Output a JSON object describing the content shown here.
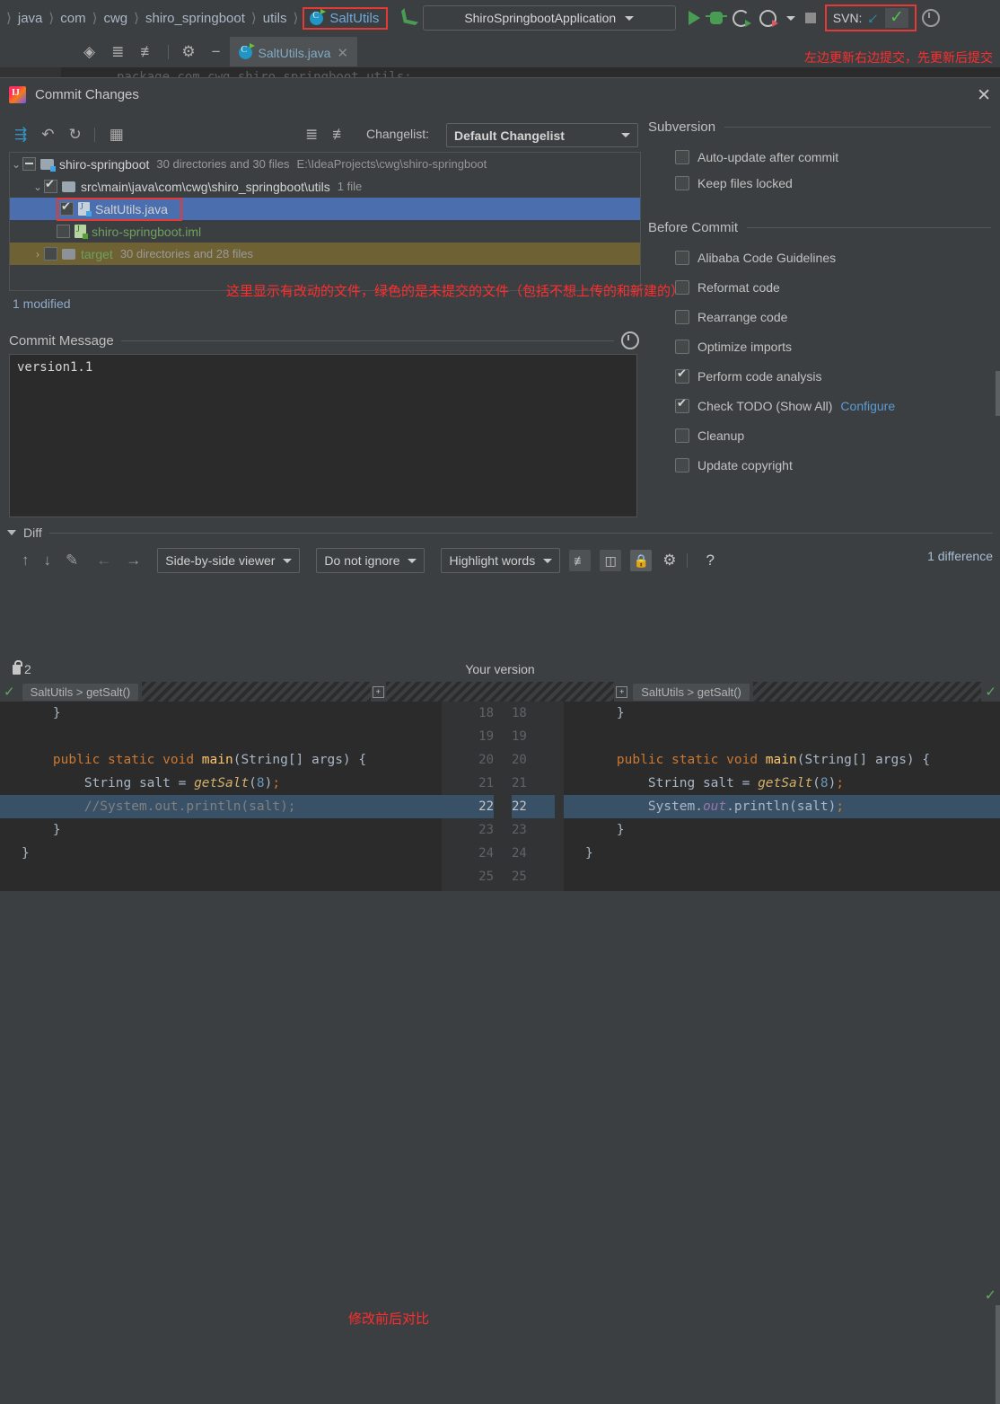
{
  "ide": {
    "breadcrumbs": [
      "java",
      "com",
      "cwg",
      "shiro_springboot",
      "utils"
    ],
    "breadcrumb_selected": "SaltUtils",
    "run_config": "ShiroSpringbootApplication",
    "svn_label": "SVN:",
    "tab_title": "SaltUtils.java",
    "editor_ghost_line": "package com.cwg.shiro_springboot.utils;",
    "annotation_top": "左边更新右边提交，先更新后提交"
  },
  "dialog": {
    "title": "Commit Changes",
    "close_label": "✕",
    "changelist_label": "Changelist:",
    "changelist_value": "Default Changelist",
    "tree": [
      {
        "name": "shiro-springboot",
        "info": "30 directories and 30 files",
        "path": "E:\\IdeaProjects\\cwg\\shiro-springboot",
        "state": "partial",
        "kind": "project"
      },
      {
        "name": "src\\main\\java\\com\\cwg\\shiro_springboot\\utils",
        "info": "1 file",
        "path": "",
        "state": "checked",
        "kind": "folder"
      },
      {
        "name": "SaltUtils.java",
        "info": "",
        "path": "",
        "state": "checked",
        "kind": "java-modified"
      },
      {
        "name": "shiro-springboot.iml",
        "info": "",
        "path": "",
        "state": "unchecked",
        "kind": "java-new"
      },
      {
        "name": "target",
        "info": "30 directories and 28 files",
        "path": "",
        "state": "unchecked",
        "kind": "folder-ignored"
      }
    ],
    "annotation_tree": "这里显示有改动的文件，绿色的是未提交的文件（包括不想上传的和新建的）",
    "modified_status": "1 modified",
    "commit_message_label": "Commit Message",
    "commit_message_value": "version1.1",
    "right_panel": {
      "section_subversion": "Subversion",
      "subversion_items": [
        {
          "label": "Auto-update after commit",
          "checked": false
        },
        {
          "label": "Keep files locked",
          "checked": false
        }
      ],
      "section_before_commit": "Before Commit",
      "before_commit_items": [
        {
          "label": "Alibaba Code Guidelines",
          "checked": false,
          "link": ""
        },
        {
          "label": "Reformat code",
          "checked": false,
          "link": ""
        },
        {
          "label": "Rearrange code",
          "checked": false,
          "link": ""
        },
        {
          "label": "Optimize imports",
          "checked": false,
          "link": ""
        },
        {
          "label": "Perform code analysis",
          "checked": true,
          "link": ""
        },
        {
          "label": "Check TODO (Show All)",
          "checked": true,
          "link": "Configure"
        },
        {
          "label": "Cleanup",
          "checked": false,
          "link": ""
        },
        {
          "label": "Update copyright",
          "checked": false,
          "link": ""
        }
      ]
    },
    "diff": {
      "section_label": "Diff",
      "viewer_mode": "Side-by-side viewer",
      "ignore_mode": "Do not ignore",
      "highlight_mode": "Highlight words",
      "help_label": "?",
      "difference_count": "1 difference",
      "lock_count": "2",
      "your_version_label": "Your version",
      "left_breadcrumb": "SaltUtils > getSalt()",
      "right_breadcrumb": "SaltUtils > getSalt()",
      "annotation": "修改前后对比",
      "line_numbers_left": [
        "18",
        "19",
        "20",
        "21",
        "22",
        "23",
        "24",
        "25"
      ],
      "line_numbers_right": [
        "18",
        "19",
        "20",
        "21",
        "22",
        "23",
        "24",
        "25"
      ],
      "left_lines": [
        "    }",
        "",
        "    public static void main(String[] args) {",
        "        String salt = getSalt(8);",
        "        //System.out.println(salt);",
        "    }",
        "}",
        ""
      ],
      "right_lines": [
        "    }",
        "",
        "    public static void main(String[] args) {",
        "        String salt = getSalt(8);",
        "        System.out.println(salt);",
        "    }",
        "}",
        ""
      ]
    }
  },
  "colors": {
    "accent_blue": "#4b6eaf",
    "annotation_red": "#ff2d2d",
    "ignored_olive": "#6e6134",
    "link_blue": "#5a9bd5",
    "green_file": "#6ea05e",
    "diff_highlight": "#395166"
  }
}
